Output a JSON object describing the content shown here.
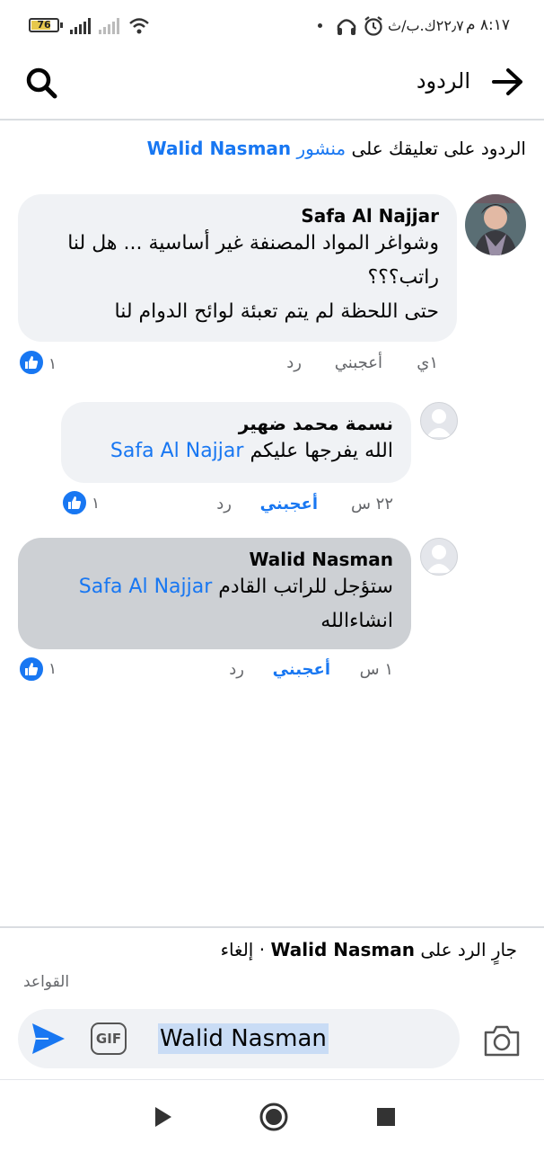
{
  "status_bar": {
    "time": "٨:١٧ م",
    "data_speed": "٢٢٫٧ك.ب/ث",
    "battery_level": "76",
    "battery_fraction": 0.76
  },
  "header": {
    "title": "الردود",
    "back_icon": "arrow-right-icon",
    "search_icon": "search-icon"
  },
  "context": {
    "prefix": "الردود على تعليقك على ",
    "post_word": "منشور",
    "author": "Walid Nasman"
  },
  "comments": [
    {
      "author": "Safa Al Najjar",
      "lines": [
        "وشواغر المواد المصنفة غير أساسية ... هل لنا راتب؟؟؟",
        "حتى اللحظة لم يتم تعبئة لوائح الدوام لنا"
      ],
      "time": "١ي",
      "like_label": "أعجبني",
      "reply_label": "رد",
      "like_count": "١",
      "liked": false
    },
    {
      "author": "نسمة محمد ضهير",
      "text": "الله يفرجها عليكم",
      "mention": "Safa Al Najjar",
      "time": "٢٢ س",
      "like_label": "أعجبني",
      "reply_label": "رد",
      "like_count": "١",
      "liked": true
    },
    {
      "author": "Walid Nasman",
      "text": "ستؤجل للراتب القادم",
      "mention": "Safa Al Najjar",
      "text2": "انشاءالله",
      "time": "١ س",
      "like_label": "أعجبني",
      "reply_label": "رد",
      "like_count": "١",
      "liked": true
    }
  ],
  "composer": {
    "replying_prefix": "جارٍ الرد على",
    "replying_to": "Walid Nasman",
    "separator": "·",
    "cancel": "إلغاء",
    "rules": "القواعد",
    "input_value": "Walid Nasman",
    "gif_label": "GIF"
  },
  "colors": {
    "accent": "#1877f2",
    "bubble": "#f0f2f5",
    "bubble_highlight": "#cdd0d4"
  }
}
